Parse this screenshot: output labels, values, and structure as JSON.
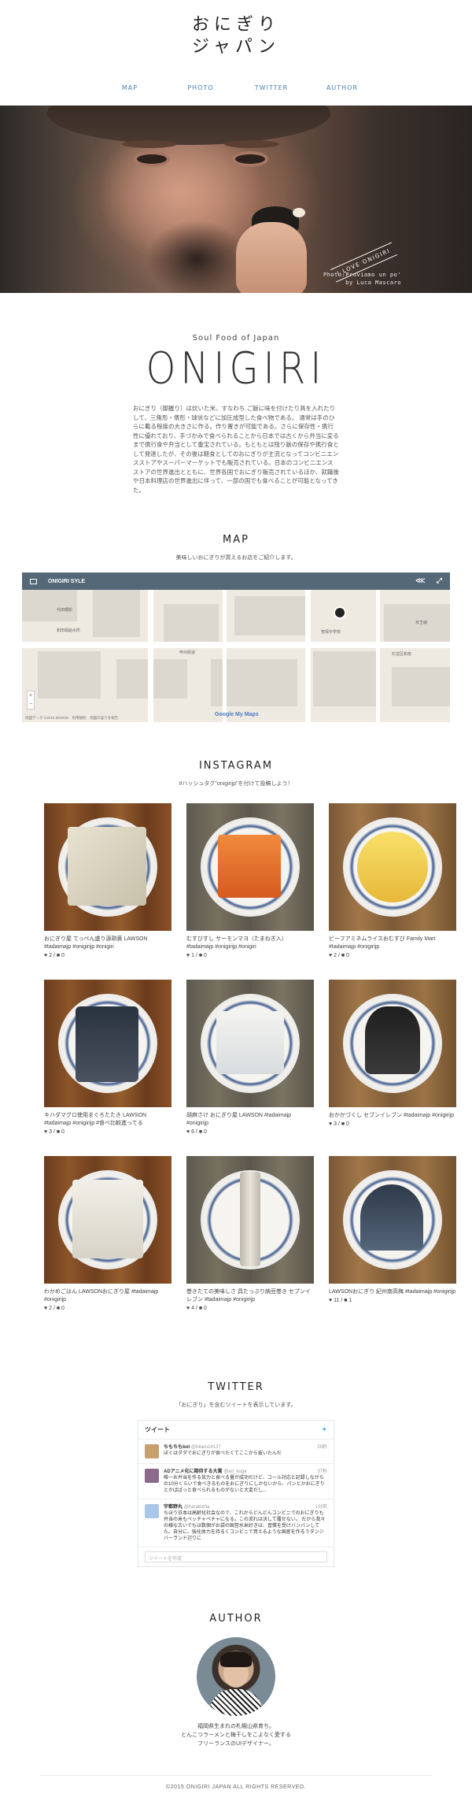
{
  "site": {
    "title_line1": "おにぎり",
    "title_line2": "ジャパン"
  },
  "nav": [
    "MAP",
    "PHOTO",
    "TWITTER",
    "AUTHOR"
  ],
  "hero": {
    "tagline": "I LOVE ONIGIRI",
    "credit_line1": "Photo:Proviamo un po'",
    "credit_line2": "by Luca Mascaro"
  },
  "intro": {
    "subtitle": "Soul Food of Japan",
    "heading": "ONIGIRI",
    "body": "おにぎり（御握り）は炊いた米、すなわち ご飯に味を付けたり具を入れたりして、三角形・俵形・球状などに加圧成型した食べ物である。 通常は手のひらに載る程度の大きさに作る。作り置きが可能である。さらに保存性・携行性に優れており、手づかみで食べられることから日本では古くから弁当に変るまで携行食や弁当として重宝されている。もともとは残り飯の保存や携行食として発達したが、その後は軽食としてのおにぎりが主流となってコンビニエンスストアやスーパーマーケットでも販売されている。日本のコンビニエンスストアの世界進出とともに、世界各国でおにぎり販売されているほか、就職後や日本料理店の世界進出に伴って、一部の国でも食べることが可能となってきた。"
  },
  "map": {
    "title": "MAP",
    "subtitle": "美味しいおにぎりが買えるお店をご紹介します。",
    "embed_title": "ONIGIRI SYLE",
    "google_label": "Google My Maps",
    "attribution": "地図データ ©2015 ZENRIN　利用規約　地図の誤りを報告",
    "zoom_in": "+",
    "zoom_out": "−",
    "place_labels": [
      "代田橋駅",
      "和田堀給水所",
      "笹塚中学校",
      "杉並区和泉",
      "甲州街道",
      "京王線"
    ]
  },
  "instagram": {
    "title": "INSTAGRAM",
    "subtitle": "#ハッシュタグ\"onigirijp\"を付けて投稿しよう！",
    "posts": [
      {
        "caption": "おにぎり屋 てっぺん盛り源熟黄 LAWSON #tadaimajp #onigirijp #onigiri",
        "stats": "♥ 2 / ■ 0",
        "bg": "wood1"
      },
      {
        "caption": "むすびすし サーモンマヨ（たまねぎ入） #tadaimajp #onigirijp #onigiri",
        "stats": "♥ 1 / ■ 0",
        "bg": "wood2"
      },
      {
        "caption": "ビーフアミネムライスおむすび Family Mart #tadaimajp #onigirijp",
        "stats": "♥ 2 / ■ 0",
        "bg": "wood3"
      },
      {
        "caption": "キハダマグロ使用まぐろたたき LAWSON #tadaimajp #onigirijp #食べ比較進ってる",
        "stats": "♥ 3 / ■ 0",
        "bg": "wood1"
      },
      {
        "caption": "胡麻さけ おにぎり屋 LAWSON #tadaimajp #onigirijp",
        "stats": "♥ 6 / ■ 0",
        "bg": "wood2"
      },
      {
        "caption": "おかかづくし セブンイレブン #tadaimajp #onigirijp",
        "stats": "♥ 3 / ■ 0",
        "bg": "wood3"
      },
      {
        "caption": "わかめごはん LAWSONおにぎり屋 #tadaimajp #onigirijp",
        "stats": "♥ 2 / ■ 0",
        "bg": "wood1"
      },
      {
        "caption": "巻きたての美味しさ 具たっぷり納豆巻き セブンイレブン #tadaimajp #onigirijp",
        "stats": "♥ 4 / ■ 0",
        "bg": "wood2"
      },
      {
        "caption": "LAWSONおにぎり 紀州南高梅 #tadaimajp #onigirijp",
        "stats": "♥ 11 / ■ 1",
        "bg": "wood3"
      }
    ]
  },
  "twitter": {
    "title": "TWITTER",
    "subtitle": "「おにぎり」を含むツイートを表示しています。",
    "widget_heading": "ツイート",
    "tweets": [
      {
        "name": "ちもちもbot",
        "handle": "@hkaru14137",
        "time": "25秒",
        "text": "ぼくはダダでおにぎりが食べたくてここから抜いたんだ"
      },
      {
        "name": "ADアニメ化に期待する大賞",
        "handle": "@ad_kuga",
        "time": "37秒",
        "text": "唯一お弁当を作る気力と食べる量が成功だけど、コール対応と記録しながらの10分くらいで食べきるものをおにぎりにしかないから、パンとかおにぎりとかばばっと食べられるものがないと大変だし..."
      },
      {
        "name": "宇都野丸",
        "handle": "@harakorita",
        "time": "1分前",
        "text": "ちほう日本は高齢化社会なので、これからどんどんコンビニでのおにぎりも弁当の米もベッチャベチャになる。この流れは決して覆せない。\n だから我々の様な古いでもは数個がお袋の国営水米好きは、習慣を受けバンバンしてた。自分に、強化体力を持るくコンビニで買えるような国産を作るうダンジバーランド辺りに"
      }
    ],
    "compose_placeholder": "ツイートを作成"
  },
  "author": {
    "title": "AUTHOR",
    "bio_line1": "福岡県生まれの札幌山県育ち。",
    "bio_line2": "とんこつラーメンと梅干しをこよなく愛する",
    "bio_line3": "フリーランスのUIデザイナー。"
  },
  "footer": {
    "copyright": "©2015 ONIGIRI JAPAN ALL RIGHTS RESERVED."
  }
}
